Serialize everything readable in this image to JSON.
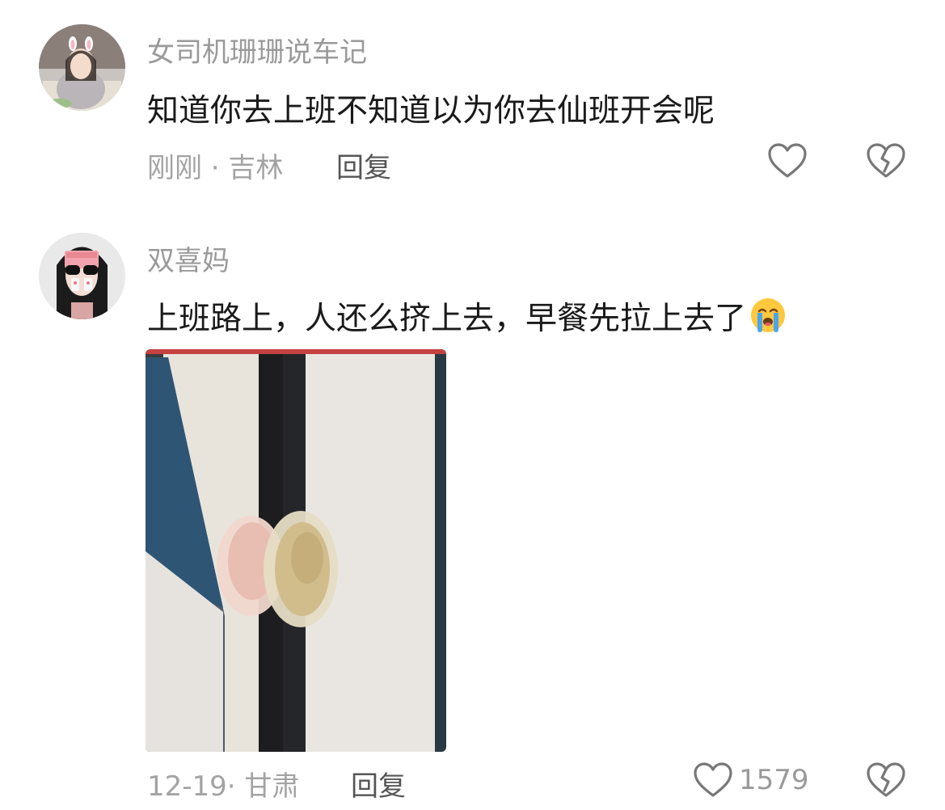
{
  "comments": [
    {
      "username": "女司机珊珊说车记",
      "text": "知道你去上班不知道以为你去仙班开会呢",
      "time_location": "刚刚 · 吉林",
      "reply_label": "回复",
      "like_count": ""
    },
    {
      "username": "双喜妈",
      "text": "上班路上，人还么挤上去，早餐先拉上去了",
      "emoji": "crying-face",
      "time_location": "12-19· 甘肃",
      "reply_label": "回复",
      "like_count": "1579"
    }
  ],
  "colors": {
    "username": "#9a9a9a",
    "text": "#1a1a1a",
    "meta": "#a3a3a3",
    "icon": "#777777"
  }
}
